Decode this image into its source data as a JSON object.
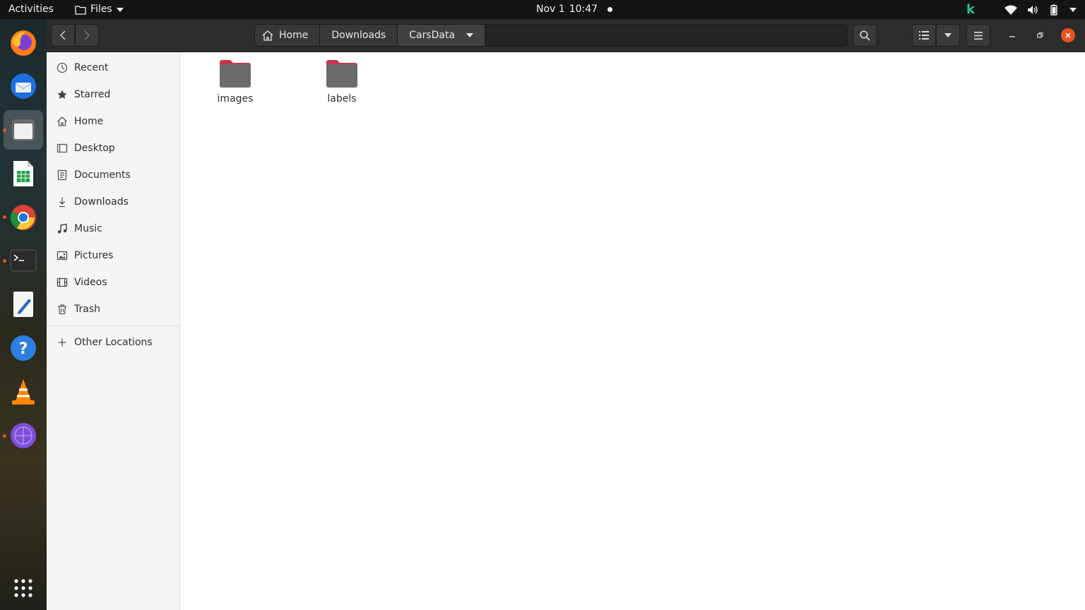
{
  "topbar": {
    "activities": "Activities",
    "app_menu_label": "Files",
    "clock_date": "Nov 1",
    "clock_time": "10:47",
    "tray_icons": [
      "k-icon",
      "wifi-icon",
      "volume-icon",
      "battery-icon",
      "chevron-down-icon"
    ]
  },
  "dock": {
    "items": [
      {
        "name": "firefox",
        "running": false
      },
      {
        "name": "thunderbird",
        "running": false
      },
      {
        "name": "files",
        "running": true,
        "active": true
      },
      {
        "name": "libreoffice-calc",
        "running": false
      },
      {
        "name": "chrome",
        "running": true
      },
      {
        "name": "terminal",
        "running": true
      },
      {
        "name": "text-editor",
        "running": false
      },
      {
        "name": "help",
        "running": false
      },
      {
        "name": "vlc",
        "running": false
      },
      {
        "name": "tor-browser",
        "running": true
      },
      {
        "name": "show-applications",
        "running": false
      }
    ]
  },
  "header": {
    "breadcrumbs": [
      "Home",
      "Downloads",
      "CarsData"
    ]
  },
  "sidebar": {
    "items": [
      {
        "label": "Recent",
        "icon": "clock-icon"
      },
      {
        "label": "Starred",
        "icon": "star-icon"
      },
      {
        "label": "Home",
        "icon": "home-icon"
      },
      {
        "label": "Desktop",
        "icon": "desktop-icon"
      },
      {
        "label": "Documents",
        "icon": "document-icon"
      },
      {
        "label": "Downloads",
        "icon": "download-icon"
      },
      {
        "label": "Music",
        "icon": "music-icon"
      },
      {
        "label": "Pictures",
        "icon": "pictures-icon"
      },
      {
        "label": "Videos",
        "icon": "videos-icon"
      },
      {
        "label": "Trash",
        "icon": "trash-icon"
      }
    ],
    "other_locations": "Other Locations"
  },
  "content": {
    "folders": [
      {
        "name": "images"
      },
      {
        "name": "labels"
      }
    ]
  },
  "colors": {
    "accent": "#e95420",
    "folder": "#6b6b6b",
    "folder_tab": "#c7344f"
  }
}
